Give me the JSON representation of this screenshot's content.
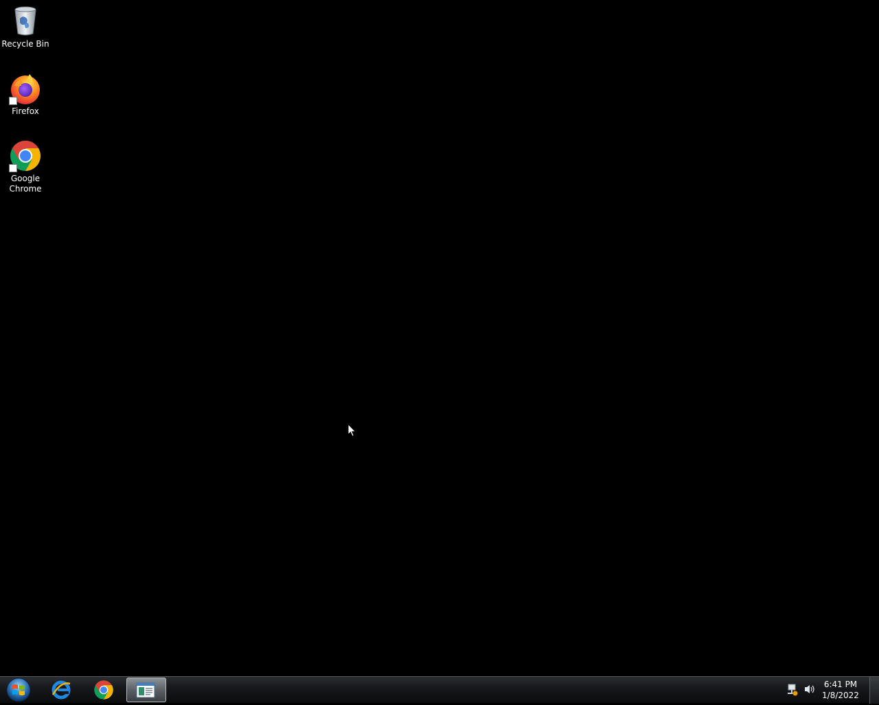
{
  "desktop": {
    "icons": [
      {
        "label": "Recycle Bin",
        "icon": "recycle-bin-icon"
      },
      {
        "label": "Firefox",
        "icon": "firefox-icon"
      },
      {
        "label": "Google\nChrome",
        "icon": "chrome-icon"
      }
    ]
  },
  "taskbar": {
    "start": {
      "icon": "windows-start-orb-icon"
    },
    "pinned": [
      {
        "name": "Internet Explorer",
        "icon": "internet-explorer-icon"
      },
      {
        "name": "Google Chrome",
        "icon": "chrome-icon"
      },
      {
        "name": "Document window",
        "icon": "document-window-icon",
        "active": true
      }
    ],
    "tray": {
      "icons": [
        "network-icon",
        "volume-icon"
      ],
      "time": "6:41 PM",
      "date": "1/8/2022"
    }
  },
  "colors": {
    "desktop_bg": "#000000",
    "firefox_orange": "#ff7b1c",
    "chrome_red": "#db4437",
    "chrome_green": "#0f9d58",
    "chrome_yellow": "#f4b400",
    "chrome_blue": "#4285f4"
  }
}
